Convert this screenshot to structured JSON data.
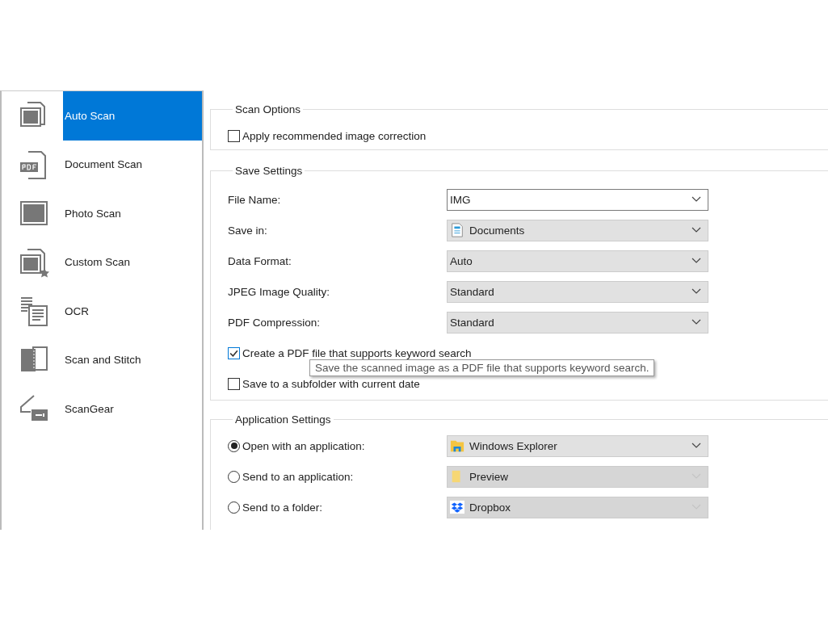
{
  "sidebar": {
    "items": [
      {
        "label": "Auto Scan",
        "selected": true
      },
      {
        "label": "Document Scan",
        "selected": false
      },
      {
        "label": "Photo Scan",
        "selected": false
      },
      {
        "label": "Custom Scan",
        "selected": false
      },
      {
        "label": "OCR",
        "selected": false
      },
      {
        "label": "Scan and Stitch",
        "selected": false
      },
      {
        "label": "ScanGear",
        "selected": false
      }
    ]
  },
  "scan_options": {
    "title": "Scan Options",
    "items": [
      {
        "kind": "checkbox",
        "label": "Apply recommended image correction",
        "checked": false
      }
    ]
  },
  "save_settings": {
    "title": "Save Settings",
    "items": [
      {
        "kind": "combo",
        "label": "File Name:",
        "value": "IMG",
        "editable": true,
        "disabled": false
      },
      {
        "kind": "combo",
        "label": "Save in:",
        "value": "Documents",
        "editable": false,
        "disabled": false
      },
      {
        "kind": "combo",
        "label": "Data Format:",
        "value": "Auto",
        "editable": false,
        "disabled": false
      },
      {
        "kind": "combo",
        "label": "JPEG Image Quality:",
        "value": "Standard",
        "editable": false,
        "disabled": false
      },
      {
        "kind": "combo",
        "label": "PDF Compression:",
        "value": "Standard",
        "editable": false,
        "disabled": false
      },
      {
        "kind": "checkbox",
        "label": "Create a PDF file that supports keyword search",
        "checked": true
      },
      {
        "kind": "checkbox",
        "label": "Save to a subfolder with current date",
        "checked": false
      }
    ]
  },
  "tooltip": {
    "text": "Save the scanned image as a PDF file that supports keyword search."
  },
  "application_settings": {
    "title": "Application Settings",
    "items": [
      {
        "label": "Open with an application:",
        "selected": true,
        "value": "Windows Explorer",
        "kind": "explorer",
        "disabled": false
      },
      {
        "label": "Send to an application:",
        "selected": false,
        "value": "Preview",
        "kind": "folder",
        "disabled": true
      },
      {
        "label": "Send to a folder:",
        "selected": false,
        "value": "Dropbox",
        "kind": "dropbox",
        "disabled": true
      }
    ]
  }
}
